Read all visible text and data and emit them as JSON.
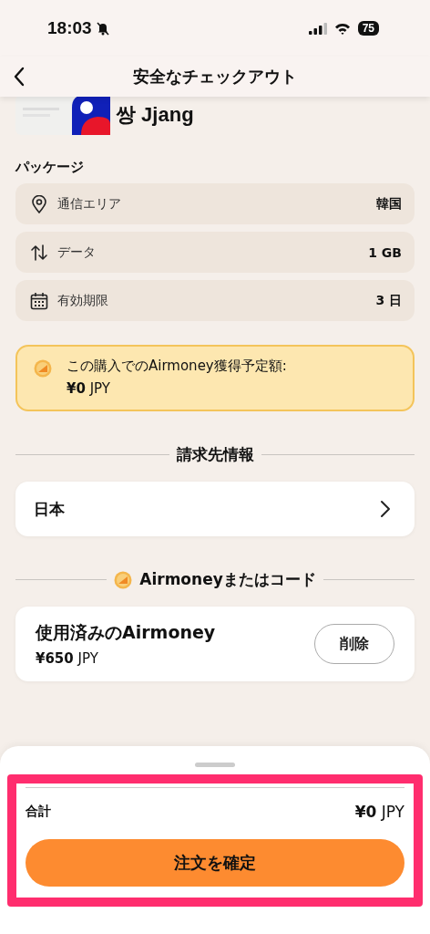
{
  "status_bar": {
    "time": "18:03",
    "battery": "75"
  },
  "header": {
    "title": "安全なチェックアウト"
  },
  "product": {
    "name": "쌍 Jjang"
  },
  "package": {
    "heading": "パッケージ",
    "rows": [
      {
        "kind": "area",
        "label": "通信エリア",
        "value": "韓国"
      },
      {
        "kind": "data",
        "label": "データ",
        "value": "1 GB"
      },
      {
        "kind": "validity",
        "label": "有効期限",
        "value": "3 日"
      }
    ]
  },
  "airmoney_notice": {
    "text": "この購入でのAirmoney獲得予定額:",
    "amount": "¥0",
    "currency": "JPY"
  },
  "billing": {
    "heading": "請求先情報",
    "country": "日本"
  },
  "airmoney_section": {
    "heading": "Airmoneyまたはコード",
    "used_label": "使用済みのAirmoney",
    "amount": "¥650",
    "currency": "JPY",
    "remove_button": "削除"
  },
  "summary": {
    "total_label": "合計",
    "total_amount": "¥0",
    "total_currency": "JPY",
    "confirm_button": "注文を確定",
    "highlighted": true
  }
}
